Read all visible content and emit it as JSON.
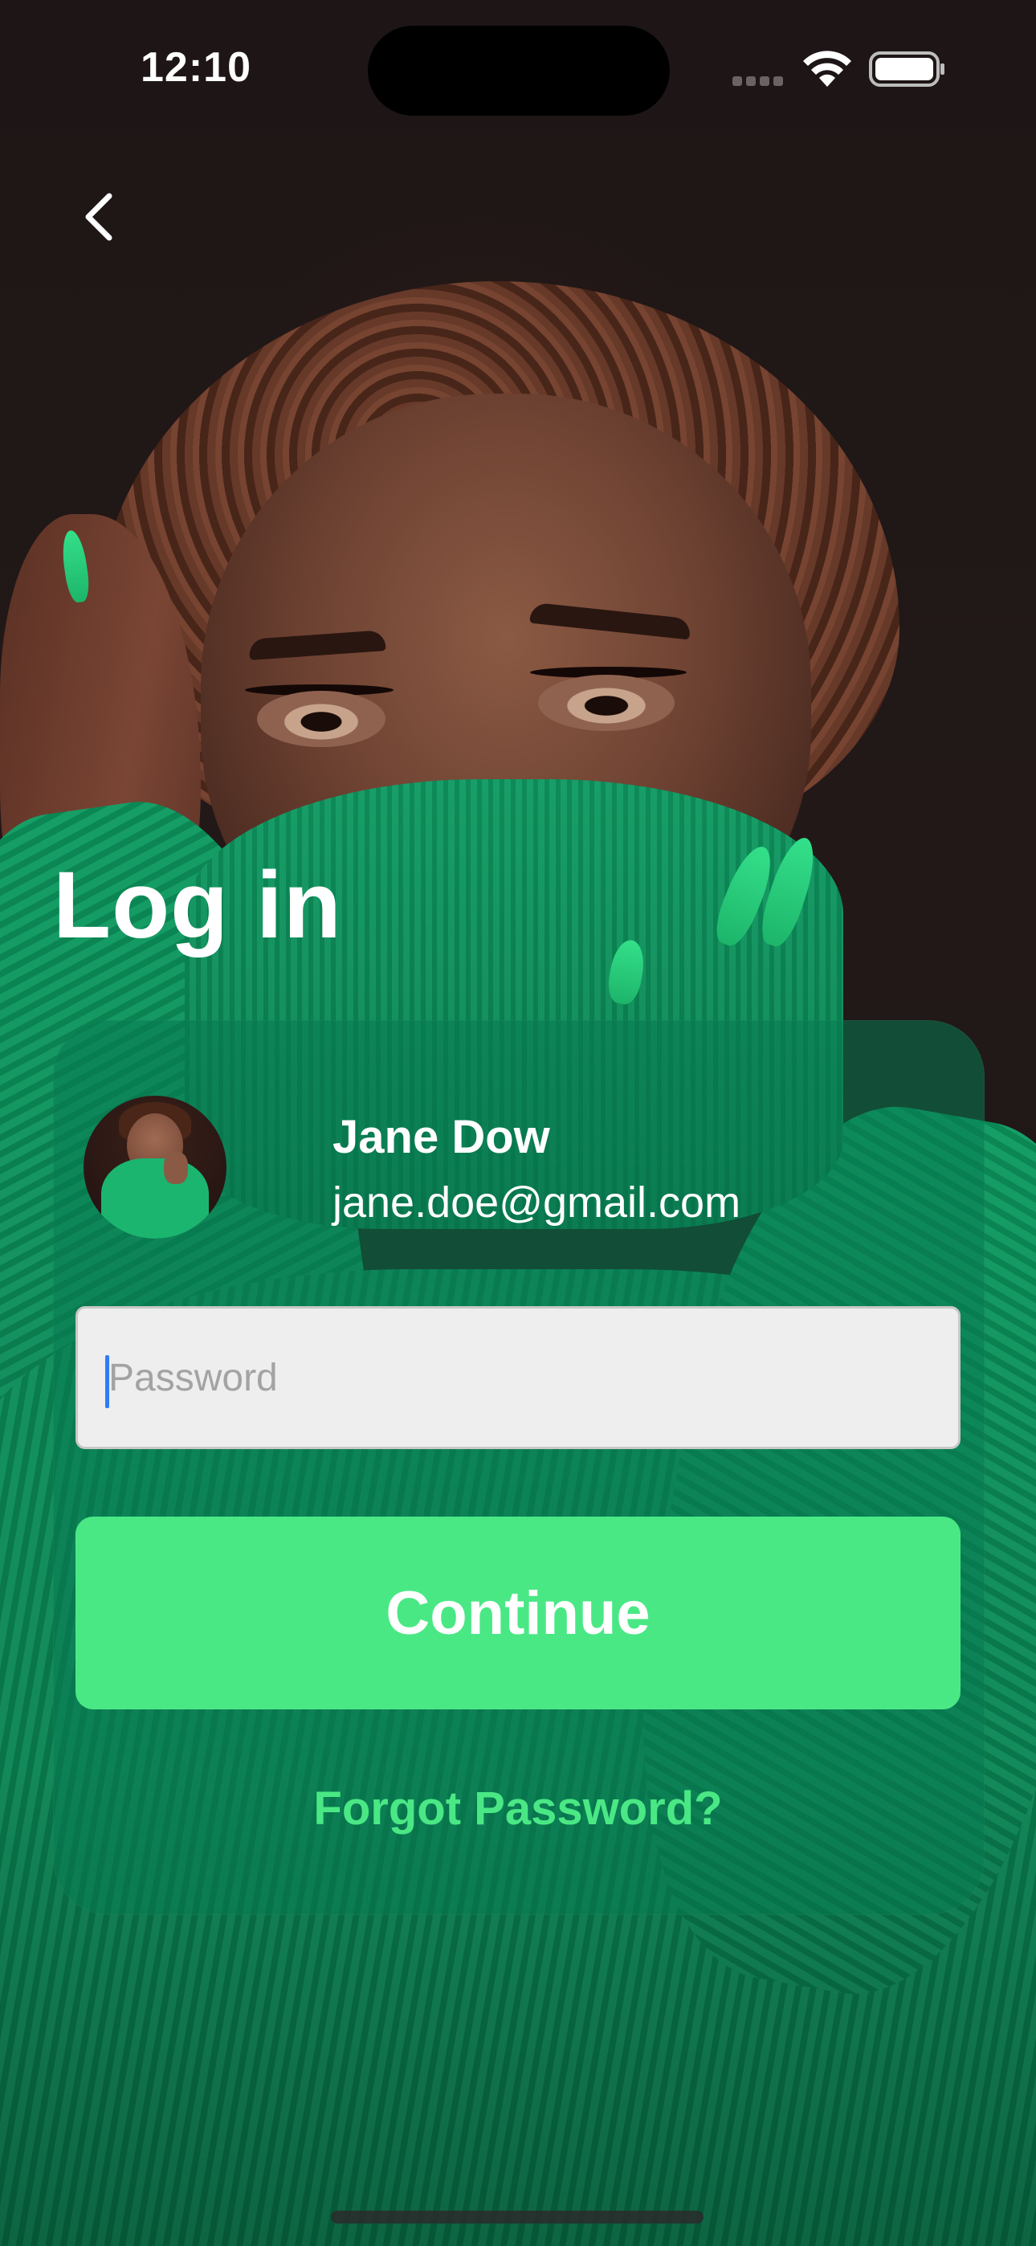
{
  "status_bar": {
    "time": "12:10",
    "wifi_icon": "wifi-icon",
    "battery_icon": "battery-icon"
  },
  "navigation": {
    "back_icon": "chevron-left-icon"
  },
  "title": "Log in",
  "user": {
    "name": "Jane Dow",
    "email": "jane.doe@gmail.com"
  },
  "password_field": {
    "placeholder": "Password",
    "value": ""
  },
  "continue_button": {
    "label": "Continue"
  },
  "forgot_password": {
    "label": "Forgot Password?"
  },
  "colors": {
    "accent": "#4ae885",
    "card_overlay": "#087a52",
    "caret": "#2f7cf6"
  }
}
